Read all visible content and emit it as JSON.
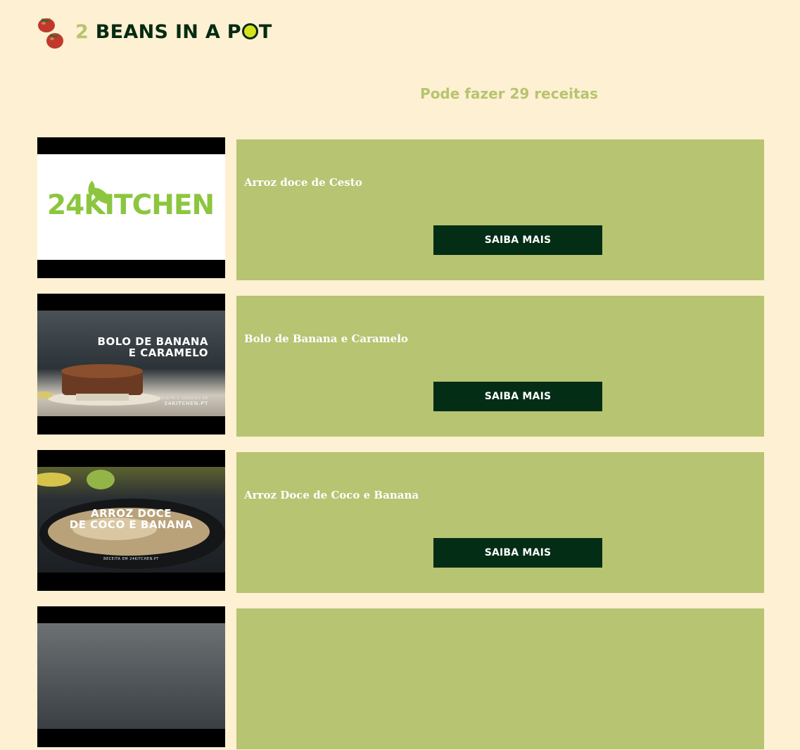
{
  "brand": {
    "number": "2",
    "text_before_o": "BEANS IN A P",
    "text_after_o": "T"
  },
  "headline": "Pode fazer 29 receitas",
  "recipes": [
    {
      "title": "Arroz doce de Cesto",
      "button": "SAIBA MAIS",
      "thumb": {
        "brand_text": "24KITCHEN"
      }
    },
    {
      "title": "Bolo de Banana e Caramelo",
      "button": "SAIBA MAIS",
      "thumb": {
        "line1": "BOLO DE BANANA",
        "line2": "E CARAMELO",
        "credit1": "RECEITA E SEGREDO EM",
        "credit2": "24KITCHEN.PT"
      }
    },
    {
      "title": "Arroz Doce de Coco e Banana",
      "button": "SAIBA MAIS",
      "thumb": {
        "line1": "ARROZ DOCE",
        "line2": "DE COCO E BANANA",
        "credit1": "RECEITA EM 24KITCHEN.PT"
      }
    },
    {
      "title": "",
      "button": ""
    }
  ],
  "colors": {
    "background": "#fef0d2",
    "card": "#b7c472",
    "button": "#042d16",
    "accent": "#b7c46f"
  }
}
